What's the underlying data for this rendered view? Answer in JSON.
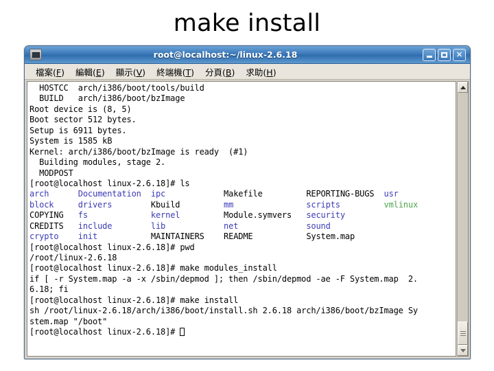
{
  "slide": {
    "title": "make install"
  },
  "window": {
    "title": "root@localhost:~/linux-2.6.18",
    "icon": "terminal-monitor-icon",
    "buttons": [
      {
        "name": "minimize",
        "glyph": "_"
      },
      {
        "name": "maximize",
        "glyph": "□"
      },
      {
        "name": "close",
        "glyph": "✕"
      }
    ]
  },
  "menu": {
    "items": [
      {
        "label": "檔案",
        "mnemonic": "F",
        "open": "(",
        "close": ")"
      },
      {
        "label": "編輯",
        "mnemonic": "E",
        "open": "(",
        "close": ")"
      },
      {
        "label": "顯示",
        "mnemonic": "V",
        "open": "(",
        "close": ")"
      },
      {
        "label": "終端機",
        "mnemonic": "T",
        "open": "(",
        "close": ")"
      },
      {
        "label": "分頁",
        "mnemonic": "B",
        "open": "(",
        "close": ")"
      },
      {
        "label": "求助",
        "mnemonic": "H",
        "open": "(",
        "close": ")"
      }
    ]
  },
  "terminal": {
    "prompt": "[root@localhost linux-2.6.18]# ",
    "lines": [
      {
        "segments": [
          {
            "text": "  HOSTCC  arch/i386/boot/tools/build",
            "color": "plain"
          }
        ]
      },
      {
        "segments": [
          {
            "text": "  BUILD   arch/i386/boot/bzImage",
            "color": "plain"
          }
        ]
      },
      {
        "segments": [
          {
            "text": "Root device is (8, 5)",
            "color": "plain"
          }
        ]
      },
      {
        "segments": [
          {
            "text": "Boot sector 512 bytes.",
            "color": "plain"
          }
        ]
      },
      {
        "segments": [
          {
            "text": "Setup is 6911 bytes.",
            "color": "plain"
          }
        ]
      },
      {
        "segments": [
          {
            "text": "System is 1585 kB",
            "color": "plain"
          }
        ]
      },
      {
        "segments": [
          {
            "text": "Kernel: arch/i386/boot/bzImage is ready  (#1)",
            "color": "plain"
          }
        ]
      },
      {
        "segments": [
          {
            "text": "  Building modules, stage 2.",
            "color": "plain"
          }
        ]
      },
      {
        "segments": [
          {
            "text": "  MODPOST",
            "color": "plain"
          }
        ]
      },
      {
        "segments": [
          {
            "text": "[root@localhost linux-2.6.18]# ls",
            "color": "plain"
          }
        ]
      },
      {
        "segments": [
          {
            "text": "arch",
            "color": "dir"
          },
          {
            "text": "      ",
            "color": "plain"
          },
          {
            "text": "Documentation",
            "color": "dir"
          },
          {
            "text": "  ",
            "color": "plain"
          },
          {
            "text": "ipc",
            "color": "dir"
          },
          {
            "text": "            ",
            "color": "plain"
          },
          {
            "text": "Makefile",
            "color": "plain"
          },
          {
            "text": "         ",
            "color": "plain"
          },
          {
            "text": "REPORTING-BUGS",
            "color": "plain"
          },
          {
            "text": "  ",
            "color": "plain"
          },
          {
            "text": "usr",
            "color": "dir"
          }
        ]
      },
      {
        "segments": [
          {
            "text": "block",
            "color": "dir"
          },
          {
            "text": "     ",
            "color": "plain"
          },
          {
            "text": "drivers",
            "color": "dir"
          },
          {
            "text": "        ",
            "color": "plain"
          },
          {
            "text": "Kbuild",
            "color": "plain"
          },
          {
            "text": "         ",
            "color": "plain"
          },
          {
            "text": "mm",
            "color": "dir"
          },
          {
            "text": "               ",
            "color": "plain"
          },
          {
            "text": "scripts",
            "color": "dir"
          },
          {
            "text": "         ",
            "color": "plain"
          },
          {
            "text": "vmlinux",
            "color": "exe"
          }
        ]
      },
      {
        "segments": [
          {
            "text": "COPYING",
            "color": "plain"
          },
          {
            "text": "   ",
            "color": "plain"
          },
          {
            "text": "fs",
            "color": "dir"
          },
          {
            "text": "             ",
            "color": "plain"
          },
          {
            "text": "kernel",
            "color": "dir"
          },
          {
            "text": "         ",
            "color": "plain"
          },
          {
            "text": "Module.symvers",
            "color": "plain"
          },
          {
            "text": "   ",
            "color": "plain"
          },
          {
            "text": "security",
            "color": "dir"
          }
        ]
      },
      {
        "segments": [
          {
            "text": "CREDITS",
            "color": "plain"
          },
          {
            "text": "   ",
            "color": "plain"
          },
          {
            "text": "include",
            "color": "dir"
          },
          {
            "text": "        ",
            "color": "plain"
          },
          {
            "text": "lib",
            "color": "dir"
          },
          {
            "text": "            ",
            "color": "plain"
          },
          {
            "text": "net",
            "color": "dir"
          },
          {
            "text": "              ",
            "color": "plain"
          },
          {
            "text": "sound",
            "color": "dir"
          }
        ]
      },
      {
        "segments": [
          {
            "text": "crypto",
            "color": "dir"
          },
          {
            "text": "    ",
            "color": "plain"
          },
          {
            "text": "init",
            "color": "dir"
          },
          {
            "text": "           ",
            "color": "plain"
          },
          {
            "text": "MAINTAINERS",
            "color": "plain"
          },
          {
            "text": "    ",
            "color": "plain"
          },
          {
            "text": "README",
            "color": "plain"
          },
          {
            "text": "           ",
            "color": "plain"
          },
          {
            "text": "System.map",
            "color": "plain"
          }
        ]
      },
      {
        "segments": [
          {
            "text": "[root@localhost linux-2.6.18]# pwd",
            "color": "plain"
          }
        ]
      },
      {
        "segments": [
          {
            "text": "/root/linux-2.6.18",
            "color": "plain"
          }
        ]
      },
      {
        "segments": [
          {
            "text": "[root@localhost linux-2.6.18]# make modules_install",
            "color": "plain"
          }
        ]
      },
      {
        "segments": [
          {
            "text": "if [ -r System.map -a -x /sbin/depmod ]; then /sbin/depmod -ae -F System.map  2.",
            "color": "plain"
          }
        ]
      },
      {
        "segments": [
          {
            "text": "6.18; fi",
            "color": "plain"
          }
        ]
      },
      {
        "segments": [
          {
            "text": "[root@localhost linux-2.6.18]# make install",
            "color": "plain"
          }
        ]
      },
      {
        "segments": [
          {
            "text": "sh /root/linux-2.6.18/arch/i386/boot/install.sh 2.6.18 arch/i386/boot/bzImage Sy",
            "color": "plain"
          }
        ]
      },
      {
        "segments": [
          {
            "text": "stem.map \"/boot\"",
            "color": "plain"
          }
        ]
      },
      {
        "segments": [
          {
            "text": "[root@localhost linux-2.6.18]# ",
            "color": "plain"
          },
          {
            "text": "",
            "color": "cursor"
          }
        ]
      }
    ],
    "colors": {
      "directory": "#3b3bb5",
      "executable": "#4ea64e",
      "plain": "#000000",
      "background": "#ffffff"
    }
  },
  "scrollbar": {
    "up_arrow": "scroll-up",
    "down_arrow": "scroll-down",
    "position": "bottom"
  }
}
